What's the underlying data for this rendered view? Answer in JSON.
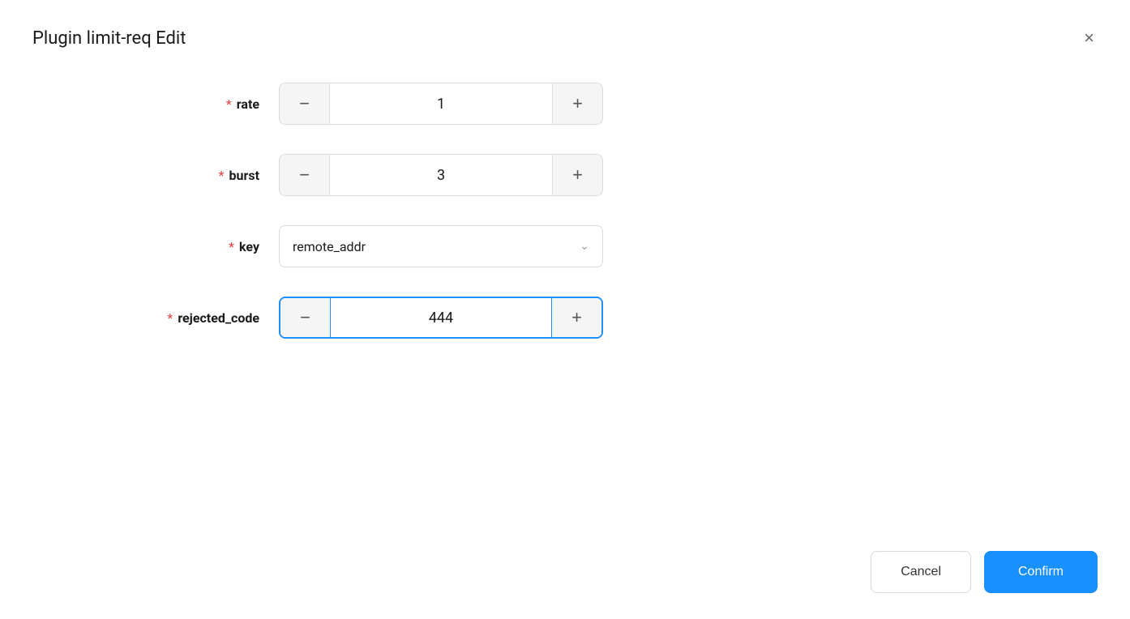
{
  "dialog": {
    "title": "Plugin limit-req Edit",
    "close_label": "×"
  },
  "fields": {
    "rate": {
      "label": "rate",
      "required": true,
      "required_symbol": "*",
      "value": "1",
      "focused": false
    },
    "burst": {
      "label": "burst",
      "required": true,
      "required_symbol": "*",
      "value": "3",
      "focused": false
    },
    "key": {
      "label": "key",
      "required": true,
      "required_symbol": "*",
      "value": "remote_addr",
      "type": "select"
    },
    "rejected_code": {
      "label": "rejected_code",
      "required": true,
      "required_symbol": "*",
      "value": "444",
      "focused": true
    }
  },
  "footer": {
    "cancel_label": "Cancel",
    "confirm_label": "Confirm"
  }
}
